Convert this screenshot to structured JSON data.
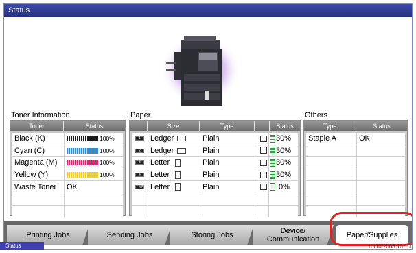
{
  "window": {
    "title": "Status"
  },
  "toner": {
    "section_label": "Toner Information",
    "headers": [
      "Toner",
      "Status"
    ],
    "rows": [
      {
        "name": "Black (K)",
        "percent": "100%",
        "color": "#1a1a1a",
        "level": 1.0
      },
      {
        "name": "Cyan (C)",
        "percent": "100%",
        "color": "#2a8fd8",
        "level": 1.0
      },
      {
        "name": "Magenta (M)",
        "percent": "100%",
        "color": "#e0226a",
        "level": 1.0
      },
      {
        "name": "Yellow (Y)",
        "percent": "100%",
        "color": "#f0cd1e",
        "level": 1.0
      },
      {
        "name": "Waste Toner",
        "status": "OK"
      }
    ]
  },
  "paper": {
    "section_label": "Paper",
    "headers": [
      "",
      "Size",
      "Type",
      "",
      "Status"
    ],
    "rows": [
      {
        "tray": "1",
        "size": "Ledger",
        "orientation": "landscape",
        "type": "Plain",
        "status": "30%"
      },
      {
        "tray": "2",
        "size": "Ledger",
        "orientation": "landscape",
        "type": "Plain",
        "status": "30%"
      },
      {
        "tray": "3",
        "size": "Letter",
        "orientation": "portrait",
        "type": "Plain",
        "status": "30%"
      },
      {
        "tray": "4",
        "size": "Letter",
        "orientation": "portrait",
        "type": "Plain",
        "status": "30%"
      },
      {
        "tray": "MP",
        "size": "Letter",
        "orientation": "portrait",
        "type": "Plain",
        "status": "0%"
      }
    ]
  },
  "others": {
    "section_label": "Others",
    "headers": [
      "Type",
      "Status"
    ],
    "rows": [
      {
        "type": "Staple A",
        "status": "OK"
      }
    ]
  },
  "tabs": [
    {
      "label": "Printing Jobs"
    },
    {
      "label": "Sending Jobs"
    },
    {
      "label": "Storing Jobs"
    },
    {
      "label": "Device/\nCommunication"
    },
    {
      "label": "Paper/Supplies"
    }
  ],
  "status_bar": {
    "status_button": "Status",
    "datetime": "10/10/2008   10:10"
  },
  "colors": {
    "title_bar": "#2f3a96",
    "highlight": "#e0231f"
  }
}
